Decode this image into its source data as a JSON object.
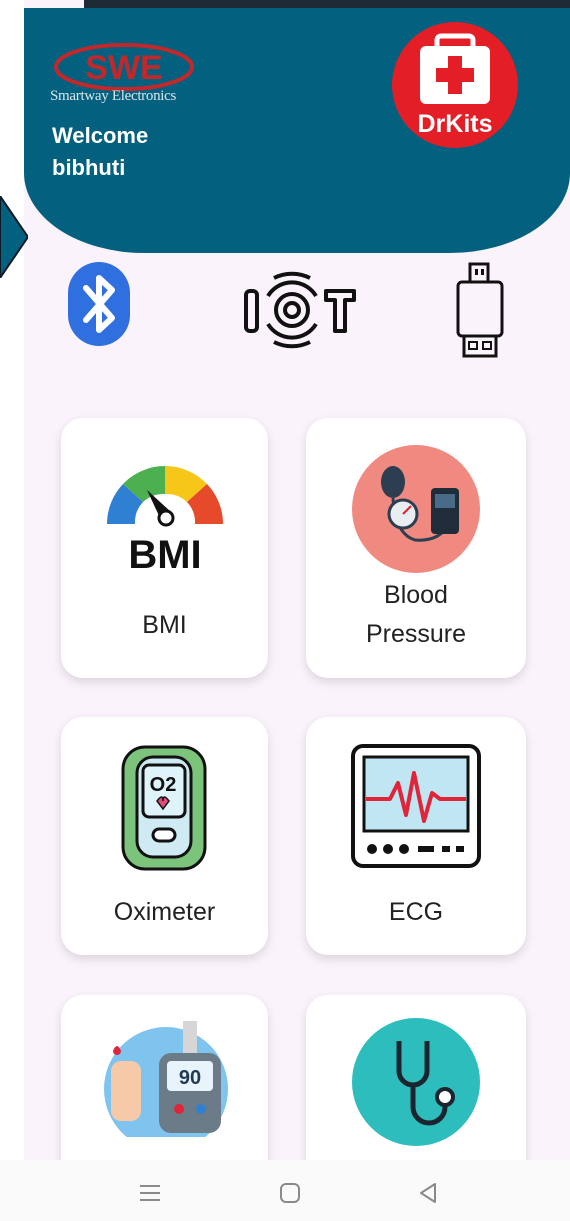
{
  "header": {
    "brand_mark": "SWE",
    "brand_name": "Smartway Electronics",
    "welcome_line": "Welcome",
    "user_name": "bibhuti",
    "app_badge": "DrKits"
  },
  "connectivity": [
    {
      "name": "bluetooth",
      "icon": "bluetooth-icon"
    },
    {
      "name": "iot",
      "icon": "iot-icon",
      "label": "IOT"
    },
    {
      "name": "usb",
      "icon": "usb-icon"
    }
  ],
  "tiles": [
    {
      "label": "BMI",
      "icon": "bmi-gauge-icon",
      "badge": "BMI"
    },
    {
      "label": "Blood Pressure",
      "icon": "blood-pressure-icon"
    },
    {
      "label": "Oximeter",
      "icon": "oximeter-icon",
      "badge": "O2"
    },
    {
      "label": "ECG",
      "icon": "ecg-monitor-icon"
    },
    {
      "label": "",
      "icon": "glucometer-icon",
      "badge": "90"
    },
    {
      "label": "",
      "icon": "stethoscope-icon"
    }
  ],
  "colors": {
    "header": "#03617f",
    "screen_bg": "#fbf3fb",
    "accent_red": "#e41e26",
    "bluetooth": "#2f6fe0"
  },
  "navbar": [
    "menu-icon",
    "home-icon",
    "back-icon"
  ]
}
